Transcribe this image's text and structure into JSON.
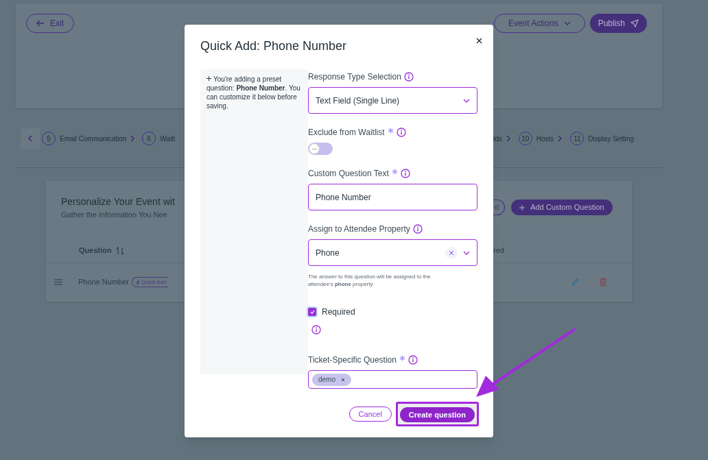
{
  "header": {
    "exit_button": "Exit",
    "event_actions_button": "Event Actions",
    "publish_button": "Publish"
  },
  "steps_left": [
    {
      "number": "5",
      "label": "Email Communication",
      "chevron": true
    },
    {
      "number": "6",
      "label": "Waitl",
      "chevron": false
    }
  ],
  "steps_right": [
    {
      "label": "lds",
      "chevron": true
    },
    {
      "number": "10",
      "label": "Hosts",
      "chevron": true
    },
    {
      "number": "11",
      "label": "Display Setting",
      "chevron": false
    }
  ],
  "card": {
    "title": "Personalize Your Event wit",
    "subtitle": "Gather the Information You Nee",
    "outline_button": "d",
    "add_button": "Add Custom Question",
    "columns": [
      "Question",
      "red"
    ],
    "rows": [
      {
        "question": "Phone Number",
        "badge": "Quick Add"
      }
    ]
  },
  "modal": {
    "title": "Quick Add: Phone Number",
    "note": "You're adding a preset question: **Phone Number**. You can customize it below before saving.",
    "fields": [
      {
        "kind": "select",
        "label": "Response Type Selection",
        "required": false,
        "value": "Text Field (Single Line)",
        "clearable": false
      },
      {
        "kind": "toggle",
        "label": "Exclude from Waitlist",
        "required": true,
        "on": false
      },
      {
        "kind": "text",
        "label": "Custom Question Text",
        "required": true,
        "value": "Phone Number"
      },
      {
        "kind": "select",
        "label": "Assign to Attendee Property",
        "required": false,
        "value": "Phone",
        "clearable": true,
        "help": "The answer to this question will be assigned to the attendee's **phone** property"
      },
      {
        "kind": "checkbox",
        "label": "Required",
        "checked": true
      },
      {
        "kind": "tags",
        "label": "Ticket-Specific Question",
        "required": true,
        "tags": [
          "demo"
        ]
      }
    ],
    "cancel_button": "Cancel",
    "create_button": "Create question"
  }
}
